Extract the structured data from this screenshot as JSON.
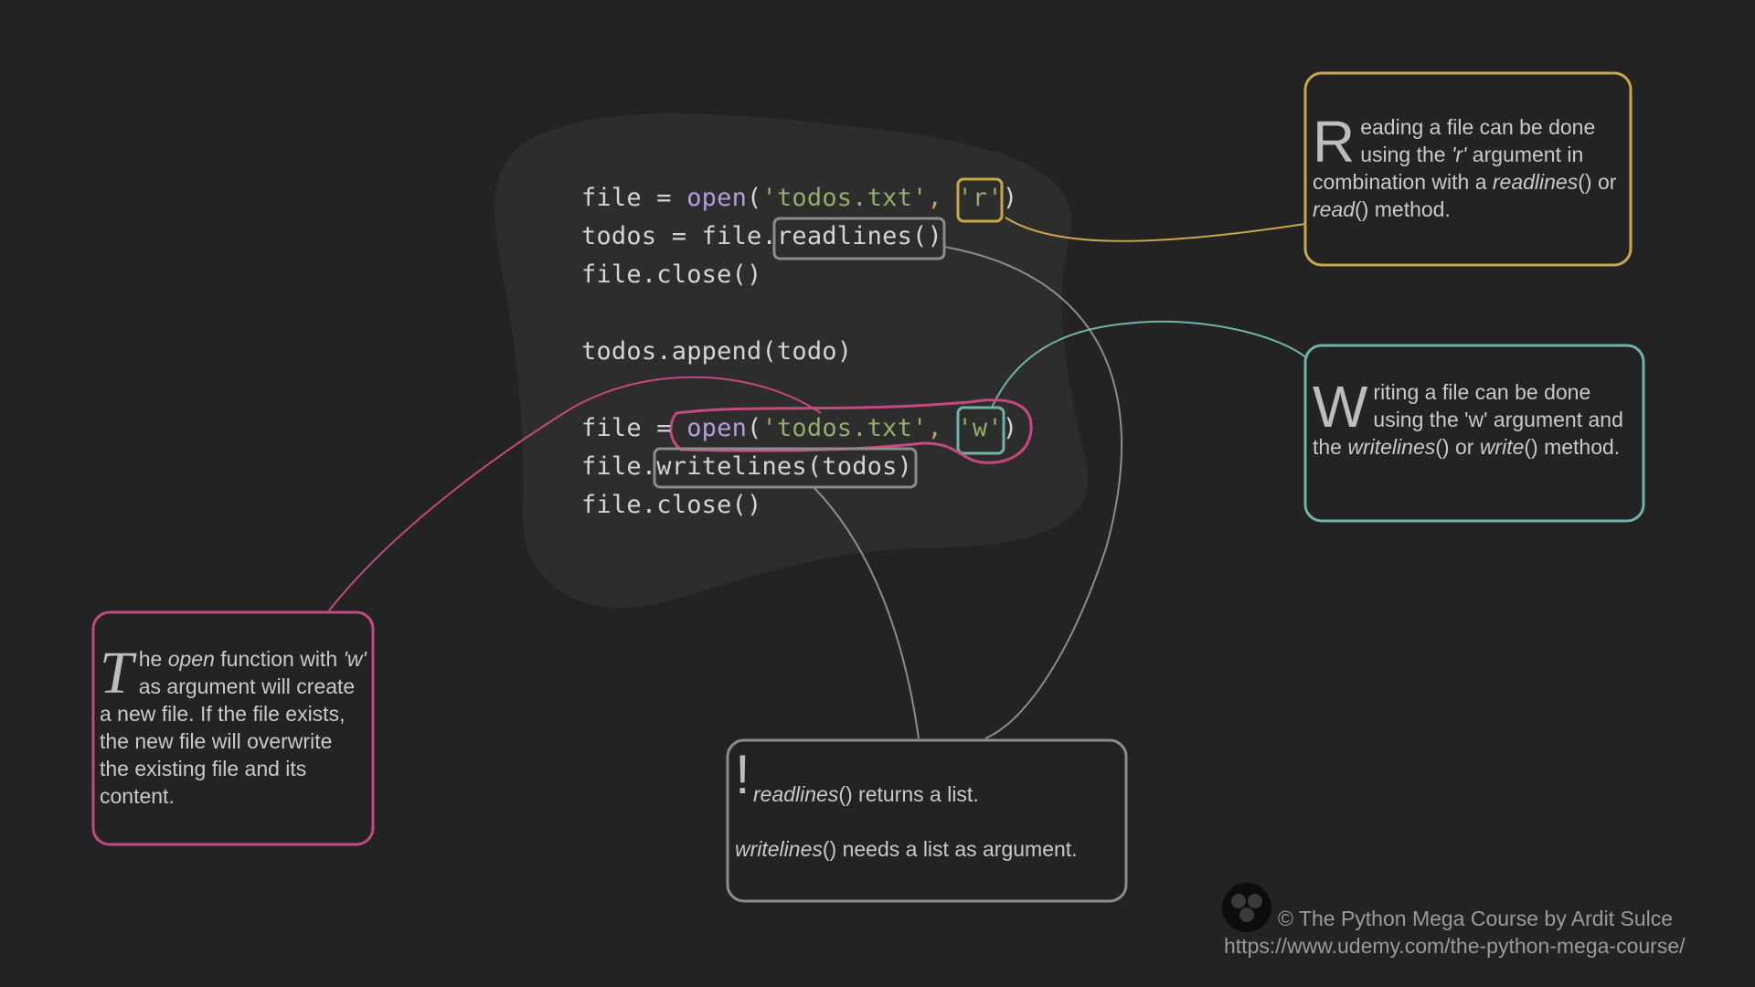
{
  "code": {
    "lines": [
      [
        {
          "t": "file = "
        },
        {
          "t": "open",
          "c": "fn"
        },
        {
          "t": "("
        },
        {
          "t": "'todos.txt'",
          "c": "str"
        },
        {
          "t": ", ",
          "c": "punct"
        },
        {
          "t": "'r'",
          "c": "str"
        },
        {
          "t": ")"
        }
      ],
      [
        {
          "t": "todos = file.readlines()"
        }
      ],
      [
        {
          "t": "file.close()"
        }
      ],
      [
        {
          "t": ""
        }
      ],
      [
        {
          "t": "todos.append(todo)"
        }
      ],
      [
        {
          "t": ""
        }
      ],
      [
        {
          "t": "file = "
        },
        {
          "t": "open",
          "c": "fn"
        },
        {
          "t": "("
        },
        {
          "t": "'todos.txt'",
          "c": "str"
        },
        {
          "t": ", ",
          "c": "punct"
        },
        {
          "t": "'w'",
          "c": "str"
        },
        {
          "t": ")"
        }
      ],
      [
        {
          "t": "file.writelines(todos)"
        }
      ],
      [
        {
          "t": "file.close()"
        }
      ]
    ]
  },
  "notes": {
    "reading": {
      "dropcap": "R",
      "parts": [
        {
          "t": "eading a file can be done using the "
        },
        {
          "t": "'r'",
          "i": true
        },
        {
          "t": " argument in combination with a "
        },
        {
          "t": "readlines",
          "i": true
        },
        {
          "t": "() or "
        },
        {
          "t": "read",
          "i": true
        },
        {
          "t": "() method."
        }
      ]
    },
    "writing": {
      "dropcap": "W",
      "parts": [
        {
          "t": "riting a file can be done using the 'w' argument and the "
        },
        {
          "t": "writelines",
          "i": true
        },
        {
          "t": "() or "
        },
        {
          "t": "write",
          "i": true
        },
        {
          "t": "() method."
        }
      ]
    },
    "open_fn": {
      "dropcap": "T",
      "parts": [
        {
          "t": "he "
        },
        {
          "t": "open",
          "i": true
        },
        {
          "t": " function with "
        },
        {
          "t": "'w'",
          "i": true
        },
        {
          "t": " as argument will create a new file. If the file exists, the new file will overwrite the existing file and its content."
        }
      ]
    },
    "lists": {
      "mark": "!",
      "line1": [
        {
          "t": "readlines",
          "i": true
        },
        {
          "t": "() returns a list."
        }
      ],
      "line2": [
        {
          "t": "writelines",
          "i": true
        },
        {
          "t": "() needs a list as argument."
        }
      ]
    }
  },
  "footer": {
    "copyright": "© The Python Mega Course by Ardit Sulce",
    "url": "https://www.udemy.com/the-python-mega-course/"
  },
  "colors": {
    "background": "#232323",
    "code_blob": "#2d2d2d",
    "yellow": "#c7a74a",
    "teal": "#6fb3a9",
    "pink": "#c5497e",
    "gray": "#8c8c8c"
  },
  "icons": [
    "logo-icon"
  ]
}
